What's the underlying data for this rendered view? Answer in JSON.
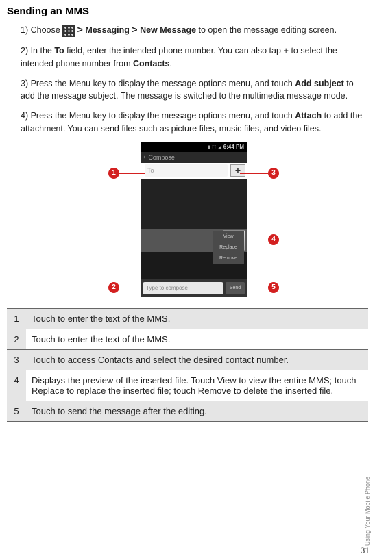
{
  "title": "Sending an MMS",
  "steps": {
    "s1a": "1)    Choose ",
    "s1_gt1": ">",
    "s1_messaging": "Messaging",
    "s1_gt2": ">",
    "s1_newmsg": "New Message",
    "s1b": " to open the message editing screen.",
    "s2a": "2)    In the ",
    "s2_to": "To",
    "s2b": " field, enter the intended phone number. You can also tap ",
    "s2_plus": "+",
    "s2c": " to select the intended phone number from ",
    "s2_contacts": "Contacts",
    "s2d": ".",
    "s3a": "3)    Press the Menu key to display the message options menu, and touch ",
    "s3_add": "Add subject",
    "s3b": " to add the message subject. The message is switched to the multimedia message mode.",
    "s4a": "4)    Press the Menu key to display the message options menu, and touch ",
    "s4_attach": "Attach",
    "s4b": " to add the attachment. You can send files such as picture files, music files, and video files."
  },
  "screenshot": {
    "time": "6:44 PM",
    "header": "Compose",
    "to_placeholder": "To",
    "menu": {
      "view": "View",
      "replace": "Replace",
      "remove": "Remove"
    },
    "compose_placeholder": "Type to compose",
    "send": "Send"
  },
  "callouts": {
    "c1": "1",
    "c2": "2",
    "c3": "3",
    "c4": "4",
    "c5": "5"
  },
  "legend": [
    {
      "num": "1",
      "text": "Touch to enter the text of the MMS."
    },
    {
      "num": "2",
      "text": "Touch to enter the text of the MMS."
    },
    {
      "num": "3",
      "text": "Touch to access Contacts and select the desired contact number."
    },
    {
      "num": "4",
      "text": "Displays the preview of the inserted file. Touch View to view the entire MMS; touch Replace to replace the inserted file; touch Remove to delete the inserted file."
    },
    {
      "num": "5",
      "text": "Touch to send the message after the editing."
    }
  ],
  "sideLabel": "Using Your Mobile Phone",
  "pageNum": "31"
}
